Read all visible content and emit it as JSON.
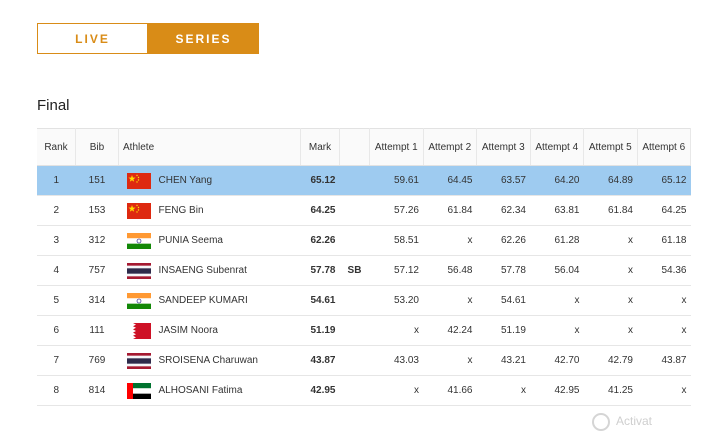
{
  "tabs": {
    "live": "LIVE",
    "series": "SERIES",
    "active": "series"
  },
  "section_title": "Final",
  "columns": {
    "rank": "Rank",
    "bib": "Bib",
    "athlete": "Athlete",
    "mark": "Mark",
    "attempts": [
      "Attempt 1",
      "Attempt 2",
      "Attempt 3",
      "Attempt 4",
      "Attempt 5",
      "Attempt 6"
    ]
  },
  "rows": [
    {
      "rank": "1",
      "bib": "151",
      "flag": "china-flag",
      "athlete": "CHEN Yang",
      "mark": "65.12",
      "note": "",
      "attempts": [
        "59.61",
        "64.45",
        "63.57",
        "64.20",
        "64.89",
        "65.12"
      ],
      "selected": true
    },
    {
      "rank": "2",
      "bib": "153",
      "flag": "china-flag",
      "athlete": "FENG Bin",
      "mark": "64.25",
      "note": "",
      "attempts": [
        "57.26",
        "61.84",
        "62.34",
        "63.81",
        "61.84",
        "64.25"
      ]
    },
    {
      "rank": "3",
      "bib": "312",
      "flag": "india-flag",
      "athlete": "PUNIA Seema",
      "mark": "62.26",
      "note": "",
      "attempts": [
        "58.51",
        "x",
        "62.26",
        "61.28",
        "x",
        "61.18"
      ]
    },
    {
      "rank": "4",
      "bib": "757",
      "flag": "thailand-flag",
      "athlete": "INSAENG Subenrat",
      "mark": "57.78",
      "note": "SB",
      "attempts": [
        "57.12",
        "56.48",
        "57.78",
        "56.04",
        "x",
        "54.36"
      ]
    },
    {
      "rank": "5",
      "bib": "314",
      "flag": "india-flag",
      "athlete": "SANDEEP KUMARI",
      "mark": "54.61",
      "note": "",
      "attempts": [
        "53.20",
        "x",
        "54.61",
        "x",
        "x",
        "x"
      ]
    },
    {
      "rank": "6",
      "bib": "111",
      "flag": "bahrain-flag",
      "athlete": "JASIM Noora",
      "mark": "51.19",
      "note": "",
      "attempts": [
        "x",
        "42.24",
        "51.19",
        "x",
        "x",
        "x"
      ]
    },
    {
      "rank": "7",
      "bib": "769",
      "flag": "thailand-flag",
      "athlete": "SROISENA Charuwan",
      "mark": "43.87",
      "note": "",
      "attempts": [
        "43.03",
        "x",
        "43.21",
        "42.70",
        "42.79",
        "43.87"
      ]
    },
    {
      "rank": "8",
      "bib": "814",
      "flag": "uae-flag",
      "athlete": "ALHOSANI Fatima",
      "mark": "42.95",
      "note": "",
      "attempts": [
        "x",
        "41.66",
        "x",
        "42.95",
        "41.25",
        "x"
      ]
    }
  ],
  "colors": {
    "accent": "#d98c17",
    "selected_row": "#9ecbf0"
  },
  "watermark": "Activat"
}
